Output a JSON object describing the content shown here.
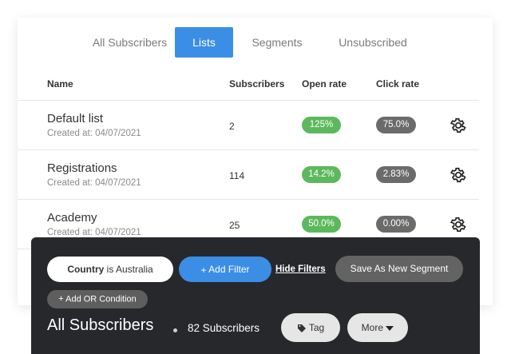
{
  "tabs": [
    {
      "label": "All Subscribers"
    },
    {
      "label": "Lists"
    },
    {
      "label": "Segments"
    },
    {
      "label": "Unsubscribed"
    }
  ],
  "table": {
    "headers": {
      "name": "Name",
      "subscribers": "Subscribers",
      "open_rate": "Open rate",
      "click_rate": "Click rate"
    },
    "rows": [
      {
        "name": "Default list",
        "created": "Created at: 04/07/2021",
        "subscribers": "2",
        "open_rate": "125%",
        "click_rate": "75.0%"
      },
      {
        "name": "Registrations",
        "created": "Created at: 04/07/2021",
        "subscribers": "114",
        "open_rate": "14.2%",
        "click_rate": "2.83%"
      },
      {
        "name": "Academy",
        "created": "Created at: 04/07/2021",
        "subscribers": "25",
        "open_rate": "50.0%",
        "click_rate": "0.00%"
      }
    ]
  },
  "filters": {
    "country_field": "Country",
    "country_operator": "is",
    "country_value": "Australia",
    "add_filter": "Add Filter",
    "hide_filters": "Hide Filters",
    "save_segment": "Save As New Segment",
    "add_or": "Add OR Condition"
  },
  "footer": {
    "title": "All Subscribers",
    "count": "82 Subscribers",
    "tag": "Tag",
    "more": "More"
  },
  "icons": {
    "row_action": "gear-icon",
    "add": "plus-icon",
    "tag": "tag-icon",
    "more": "caret-down-icon"
  },
  "colors": {
    "accent": "#3b8ee6",
    "open_rate": "#5cb85c",
    "click_rate": "#6b6b6b",
    "panel": "#27282c"
  }
}
